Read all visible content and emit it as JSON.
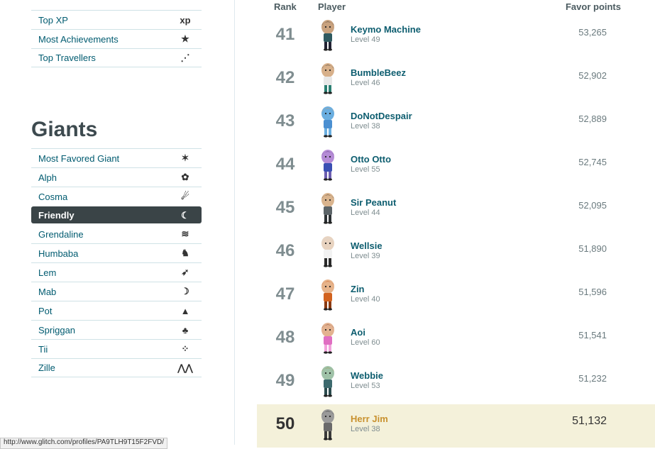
{
  "top_menu": {
    "items": [
      {
        "label": "Top XP",
        "icon": "xp-icon",
        "glyph": "xp"
      },
      {
        "label": "Most Achievements",
        "icon": "star-icon",
        "glyph": "★"
      },
      {
        "label": "Top Travellers",
        "icon": "dotted-path-icon",
        "glyph": "⋰"
      }
    ]
  },
  "giants": {
    "title": "Giants",
    "items": [
      {
        "label": "Most Favored Giant",
        "icon": "burst-icon",
        "glyph": "✶"
      },
      {
        "label": "Alph",
        "icon": "alph-icon",
        "glyph": "✿"
      },
      {
        "label": "Cosma",
        "icon": "cosma-icon",
        "glyph": "☄"
      },
      {
        "label": "Friendly",
        "icon": "friendly-icon",
        "glyph": "☾"
      },
      {
        "label": "Grendaline",
        "icon": "grendaline-icon",
        "glyph": "≋"
      },
      {
        "label": "Humbaba",
        "icon": "humbaba-icon",
        "glyph": "♞"
      },
      {
        "label": "Lem",
        "icon": "lem-icon",
        "glyph": "➶"
      },
      {
        "label": "Mab",
        "icon": "mab-icon",
        "glyph": "☽"
      },
      {
        "label": "Pot",
        "icon": "pot-icon",
        "glyph": "▲"
      },
      {
        "label": "Spriggan",
        "icon": "tree-icon",
        "glyph": "♣"
      },
      {
        "label": "Tii",
        "icon": "domino-icon",
        "glyph": "⁘"
      },
      {
        "label": "Zille",
        "icon": "mountains-icon",
        "glyph": "⋀⋀"
      }
    ],
    "active_index": 3
  },
  "leaderboard": {
    "headers": {
      "rank": "Rank",
      "player": "Player",
      "points": "Favor points"
    },
    "rows": [
      {
        "rank": "41",
        "name": "Keymo Machine",
        "level": "Level 49",
        "points": "53,265",
        "skin": "#c9a27e",
        "hair": "#2d2d2d",
        "shirt": "#2f5a60",
        "pants": "#223"
      },
      {
        "rank": "42",
        "name": "BumbleBeez",
        "level": "Level 46",
        "points": "52,902",
        "skin": "#d7b08a",
        "hair": "#1e1e1e",
        "shirt": "#e8e8e8",
        "pants": "#2a7f72"
      },
      {
        "rank": "43",
        "name": "DoNotDespair",
        "level": "Level 38",
        "points": "52,889",
        "skin": "#6aaee0",
        "hair": "#e39a57",
        "shirt": "#4a8fd1",
        "pants": "#6aaee0"
      },
      {
        "rank": "44",
        "name": "Otto Otto",
        "level": "Level 55",
        "points": "52,745",
        "skin": "#b58bd6",
        "hair": "#5a3a7a",
        "shirt": "#3a4fb3",
        "pants": "#6c5db0"
      },
      {
        "rank": "45",
        "name": "Sir Peanut",
        "level": "Level 44",
        "points": "52,095",
        "skin": "#d9b48e",
        "hair": "#3b2a1e",
        "shirt": "#5c6468",
        "pants": "#2c3134"
      },
      {
        "rank": "46",
        "name": "Wellsie",
        "level": "Level 39",
        "points": "51,890",
        "skin": "#e8d3c0",
        "hair": "#d8d8d8",
        "shirt": "#f2f2f2",
        "pants": "#2b2b2b"
      },
      {
        "rank": "47",
        "name": "Zin",
        "level": "Level 40",
        "points": "51,596",
        "skin": "#e6b38a",
        "hair": "#c94f16",
        "shirt": "#d2621e",
        "pants": "#8a3a12"
      },
      {
        "rank": "48",
        "name": "Aoi",
        "level": "Level 60",
        "points": "51,541",
        "skin": "#e3b290",
        "hair": "#7a3a2a",
        "shirt": "#e06fc2",
        "pants": "#f2a3dc"
      },
      {
        "rank": "49",
        "name": "Webbie",
        "level": "Level 53",
        "points": "51,232",
        "skin": "#9fc2a8",
        "hair": "#a08a3a",
        "shirt": "#3d6a6e",
        "pants": "#2b4b4e"
      },
      {
        "rank": "50",
        "name": "Herr Jim",
        "level": "Level 38",
        "points": "51,132",
        "skin": "#9a9a9a",
        "hair": "#1a1a1a",
        "shirt": "#6a6a6a",
        "pants": "#3a3a3a",
        "highlight": true
      }
    ]
  },
  "status_bar": {
    "url": "http://www.glitch.com/profiles/PA9TLH9T15F2FVD/"
  }
}
